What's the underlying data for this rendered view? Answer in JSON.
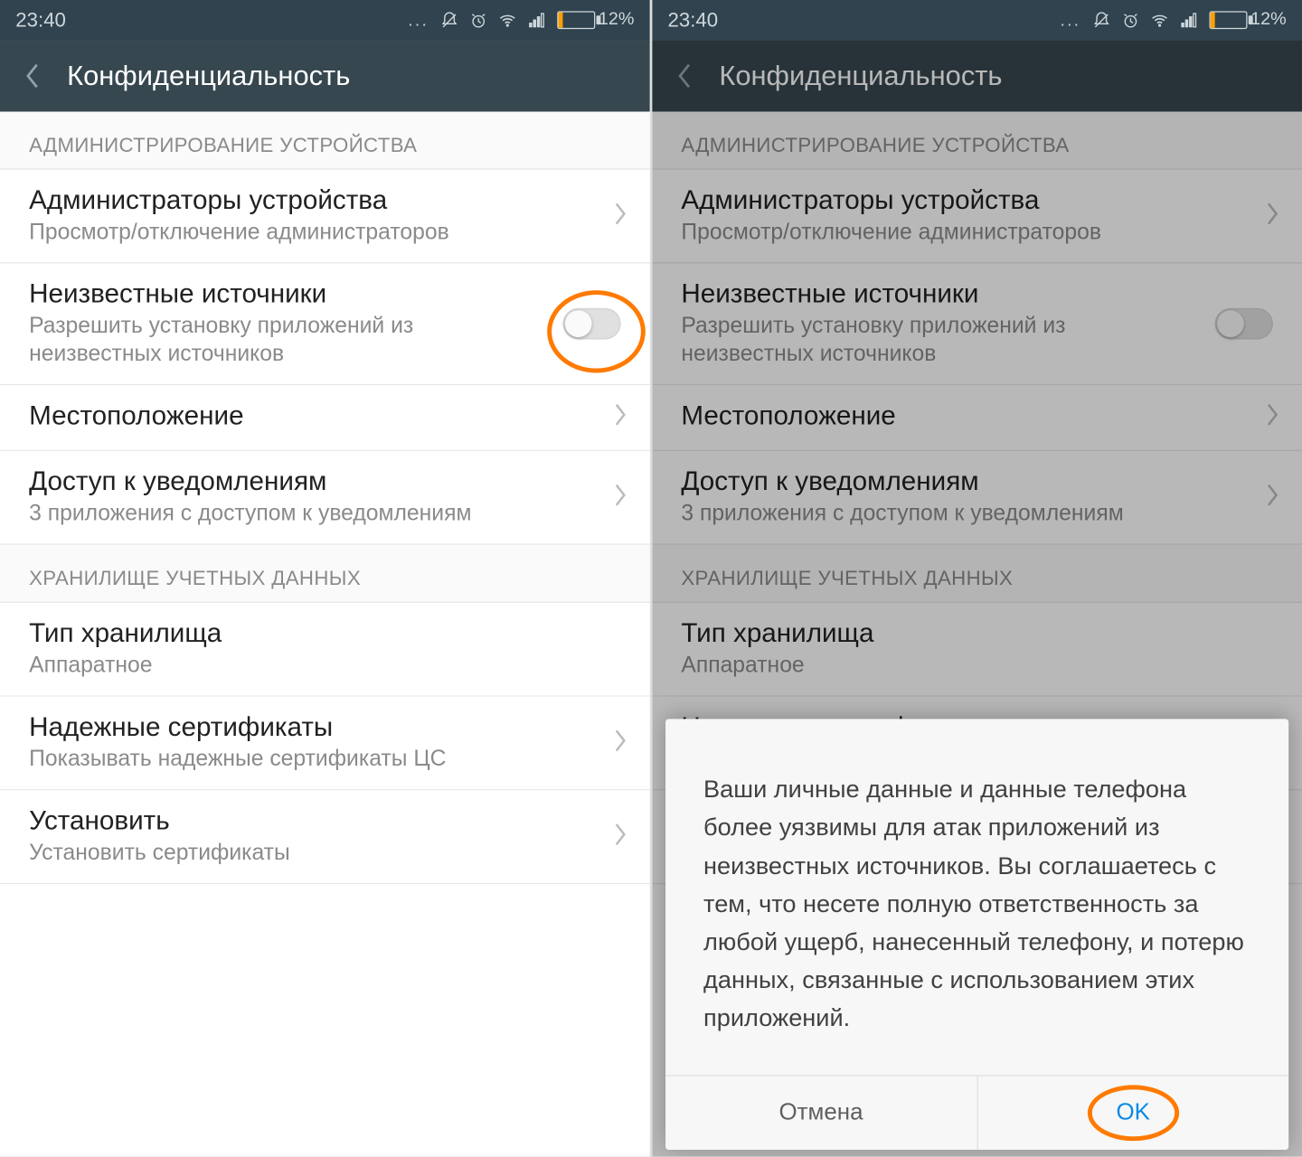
{
  "status": {
    "time": "23:40",
    "dots": "...",
    "battery_pct": "12%"
  },
  "header": {
    "title": "Конфиденциальность"
  },
  "sections": {
    "admin_header": "АДМИНИСТРИРОВАНИЕ УСТРОЙСТВА",
    "storage_header": "ХРАНИЛИЩЕ УЧЕТНЫХ ДАННЫХ"
  },
  "rows": {
    "device_admins": {
      "title": "Администраторы устройства",
      "sub": "Просмотр/отключение администраторов"
    },
    "unknown_sources": {
      "title": "Неизвестные источники",
      "sub": "Разрешить установку приложений из неизвестных источников"
    },
    "location": {
      "title": "Местоположение"
    },
    "notif_access": {
      "title": "Доступ к уведомлениям",
      "sub": "3 приложения с доступом к уведомлениям"
    },
    "storage_type": {
      "title": "Тип хранилища",
      "sub": "Аппаратное"
    },
    "trusted_certs": {
      "title": "Надежные сертификаты",
      "sub": "Показывать надежные сертификаты ЦС"
    },
    "install": {
      "title": "Установить",
      "sub": "Установить сертификаты"
    }
  },
  "dialog": {
    "body": "Ваши личные данные и данные телефона более уязвимы для атак приложений из неизвестных источников. Вы соглашаетесь с тем, что несете полную ответственность за любой ущерб, нанесенный телефону, и потерю данных, связанные с использованием этих приложений.",
    "cancel": "Отмена",
    "ok": "OK"
  }
}
